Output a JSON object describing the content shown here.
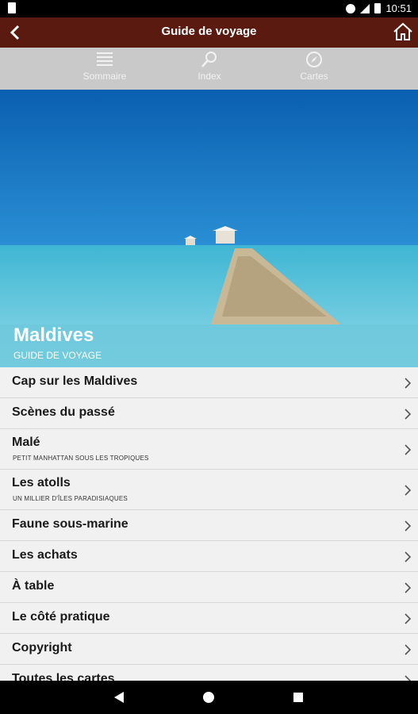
{
  "status": {
    "time": "10:51"
  },
  "appbar": {
    "title": "Guide de voyage"
  },
  "tabs": [
    {
      "label": "Sommaire",
      "icon": "list-icon"
    },
    {
      "label": "Index",
      "icon": "search-icon"
    },
    {
      "label": "Cartes",
      "icon": "compass-icon"
    }
  ],
  "hero": {
    "title": "Maldives",
    "subtitle": "GUIDE DE VOYAGE"
  },
  "menu": [
    {
      "label": "Cap sur les Maldives",
      "sub": ""
    },
    {
      "label": "Scènes du passé",
      "sub": ""
    },
    {
      "label": "Malé",
      "sub": "PETIT MANHATTAN SOUS LES TROPIQUES"
    },
    {
      "label": "Les atolls",
      "sub": "UN MILLIER D'ÎLES PARADISIAQUES"
    },
    {
      "label": "Faune sous-marine",
      "sub": ""
    },
    {
      "label": "Les achats",
      "sub": ""
    },
    {
      "label": "À table",
      "sub": ""
    },
    {
      "label": "Le côté pratique",
      "sub": ""
    },
    {
      "label": "Copyright",
      "sub": ""
    },
    {
      "label": "Toutes les cartes",
      "sub": ""
    }
  ],
  "colors": {
    "appbar": "#5a1a0f",
    "tabs": "#c9c9c9",
    "list": "#f1f1f1"
  }
}
